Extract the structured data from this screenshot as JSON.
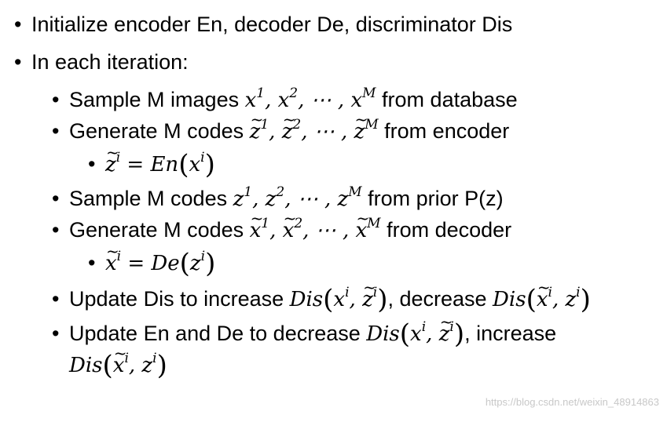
{
  "bullets": {
    "b1": "Initialize encoder En, decoder De, discriminator Dis",
    "b2": "In each iteration:",
    "s1_pre": "Sample M images ",
    "s1_post": " from database",
    "s2_pre": "Generate M codes ",
    "s2_post": " from encoder",
    "s4_pre": "Sample M codes ",
    "s4_post": " from prior P(z)",
    "s5_pre": "Generate M codes ",
    "s5_post": " from decoder",
    "s7_pre": "Update Dis to increase ",
    "s7_mid": ", decrease ",
    "s8_pre": "Update En and De to decrease ",
    "s8_post": ", increase"
  },
  "watermark": "https://blog.csdn.net/weixin_48914863"
}
